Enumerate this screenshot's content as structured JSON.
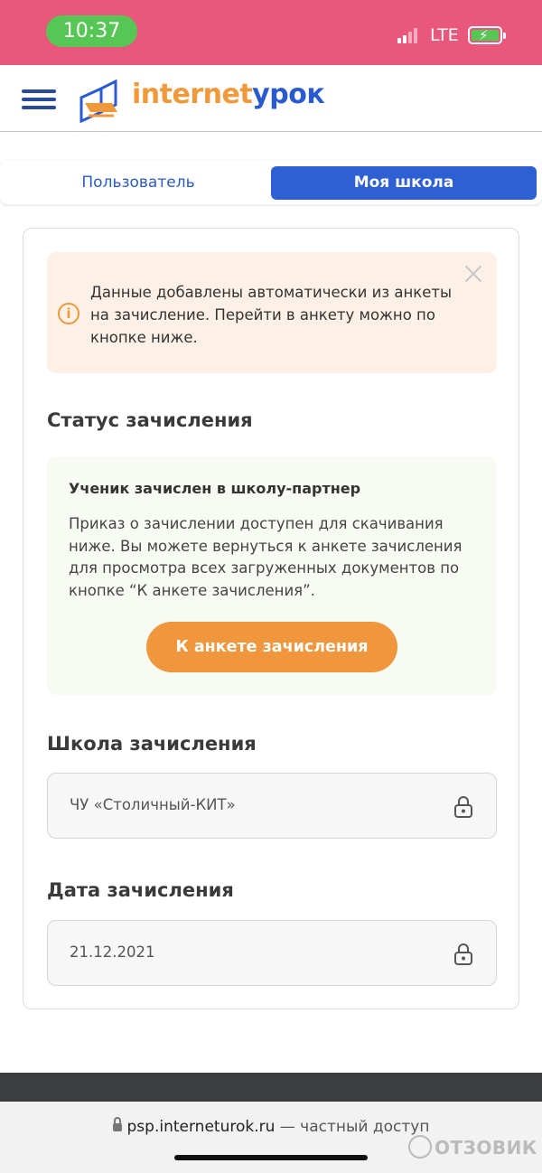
{
  "status_bar": {
    "time": "10:37",
    "network": "LTE"
  },
  "header": {
    "logo_part1": "internet",
    "logo_part2": "урок"
  },
  "tabs": [
    {
      "label": "Пользователь",
      "active": false
    },
    {
      "label": "Моя школа",
      "active": true
    }
  ],
  "notice": {
    "text": "Данные добавлены автоматически из анкеты на зачисление. Перейти в анкету можно по кнопке ниже."
  },
  "enrollment_status": {
    "title": "Статус зачисления",
    "headline": "Ученик зачислен в школу-партнер",
    "body": "Приказ о зачислении доступен для скачивания ниже. Вы можете вернуться к анкете зачисления для просмотра всех загруженных документов по кнопке “К анкете зачисления”.",
    "button_label": "К анкете зачисления"
  },
  "school": {
    "title": "Школа зачисления",
    "value": "ЧУ «Столичный-КИТ»"
  },
  "date": {
    "title": "Дата зачисления",
    "value": "21.12.2021"
  },
  "browser": {
    "domain": "psp.interneturok.ru",
    "suffix": " — частный доступ"
  },
  "watermark": "ОТЗОВИК",
  "colors": {
    "status_bar": "#e9587c",
    "brand_blue": "#2e5fd3",
    "brand_orange": "#f0963c",
    "notice_bg": "#fdf0e6"
  }
}
